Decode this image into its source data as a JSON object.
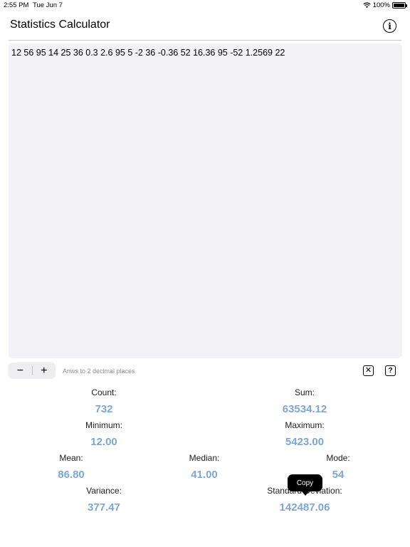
{
  "status_bar": {
    "time": "2:55 PM",
    "date": "Tue Jun 7",
    "battery": "100%",
    "battery_level": 1.0
  },
  "header": {
    "title": "Statistics Calculator",
    "info_icon": "info-circle-icon"
  },
  "editor": {
    "text": "12 56 95 14 25 36 0.3 2.6 95 5 -2 36 -0.36 52 16.36 95 -52 1.2569 22"
  },
  "toolbar": {
    "decrement": "−",
    "increment": "+",
    "precision_label": "Anws to 2 decimal places",
    "clear_icon": "clear-x-icon",
    "help_icon": "help-question-icon"
  },
  "stats": {
    "count": {
      "label": "Count:",
      "value": "732"
    },
    "sum": {
      "label": "Sum:",
      "value": "63534.12"
    },
    "minimum": {
      "label": "Minimum:",
      "value": "12.00"
    },
    "maximum": {
      "label": "Maximum:",
      "value": "5423.00"
    },
    "mean": {
      "label": "Mean:",
      "value": "86.80"
    },
    "median": {
      "label": "Median:",
      "value": "41.00"
    },
    "mode": {
      "label": "Mode:",
      "value": "54"
    },
    "variance": {
      "label": "Variance:",
      "value": "377.47"
    },
    "std_dev": {
      "label": "Standard Deviation:",
      "value": "142487.06"
    }
  },
  "tooltip": {
    "label": "Copy"
  },
  "colors": {
    "value_accent": "#7aa7da",
    "editor_bg": "#f2f2f7"
  }
}
